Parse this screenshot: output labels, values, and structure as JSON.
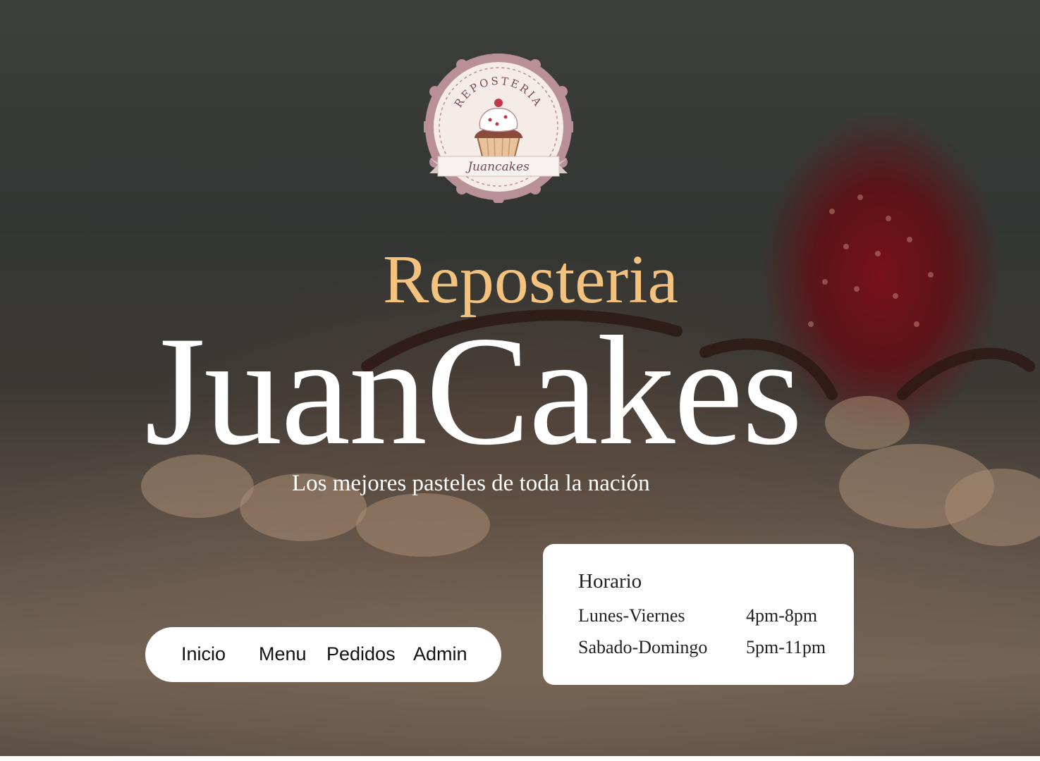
{
  "logo": {
    "arc_text": "REPOSTERIA",
    "ribbon_text": "Juancakes"
  },
  "hero": {
    "eyebrow": "Reposteria",
    "brand": "JuanCakes",
    "tagline": "Los mejores pasteles de toda la nación"
  },
  "nav": {
    "items": [
      {
        "label": "Inicio"
      },
      {
        "label": "Menu"
      },
      {
        "label": "Pedidos"
      },
      {
        "label": "Admin"
      }
    ]
  },
  "hours": {
    "title": "Horario",
    "rows": [
      {
        "days": "Lunes-Viernes",
        "time": "4pm-8pm"
      },
      {
        "days": "Sabado-Domingo",
        "time": "5pm-11pm"
      }
    ]
  },
  "colors": {
    "eyebrow": "#f2c27e",
    "brand": "#ffffff",
    "logo_badge": "#b98f98",
    "logo_text": "#7a4a55"
  }
}
